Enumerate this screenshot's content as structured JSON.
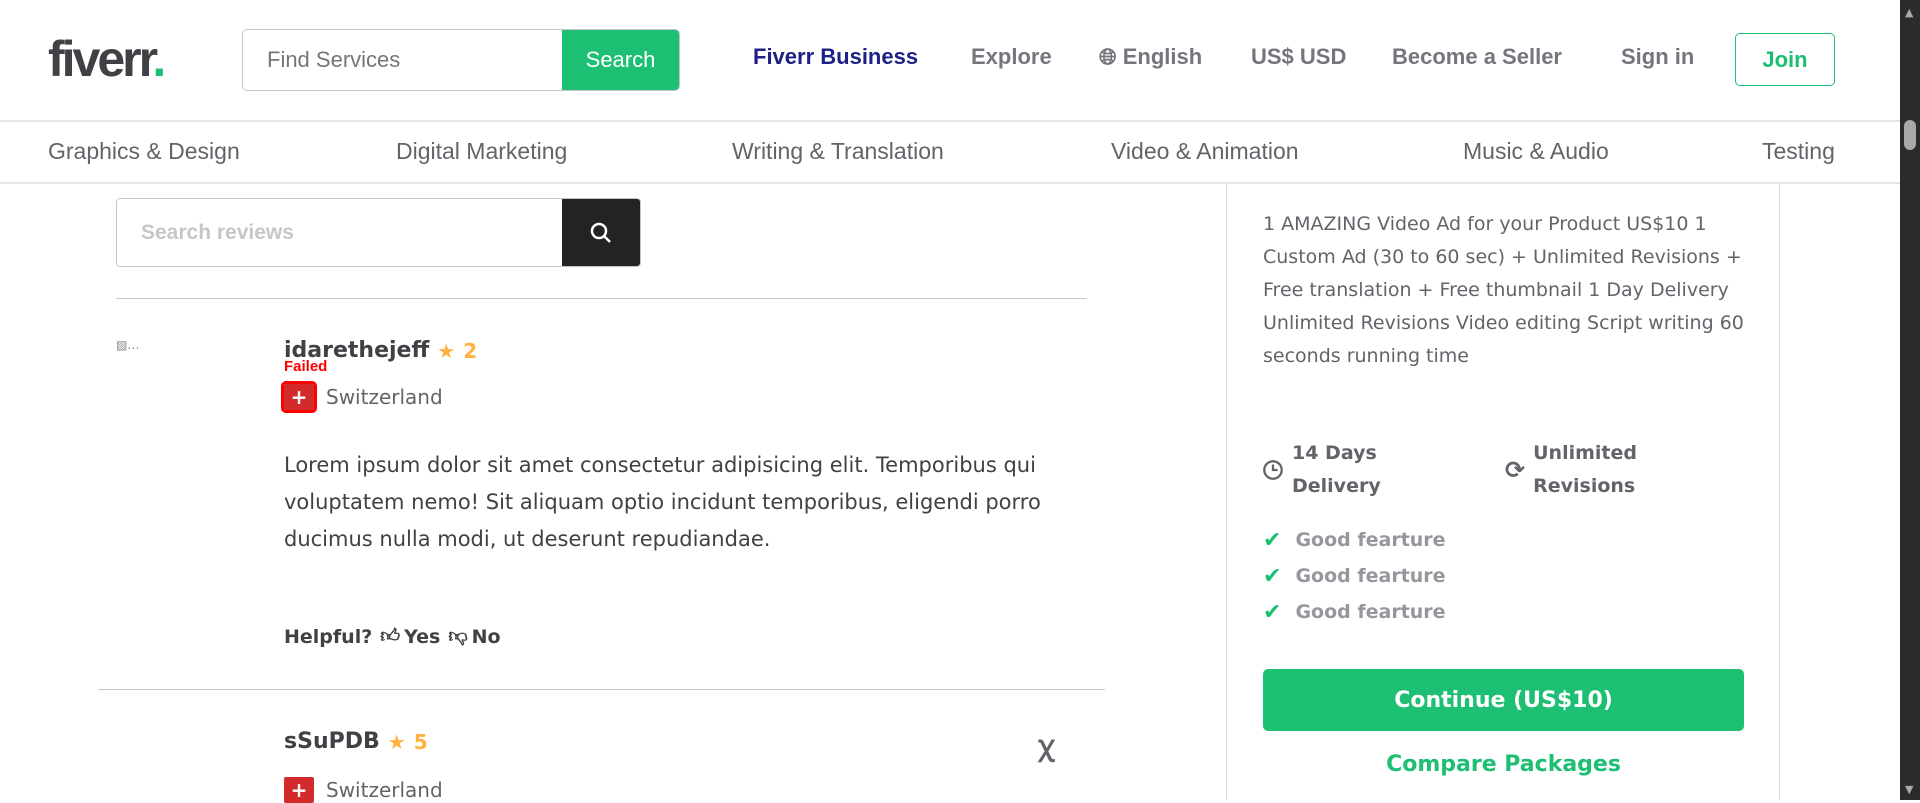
{
  "header": {
    "logo": "fiverr",
    "logo_dot": ".",
    "search_placeholder": "Find Services",
    "search_button": "Search",
    "nav": {
      "business": "Fiverr Business",
      "explore": "Explore",
      "language": "English",
      "currency": "US$ USD",
      "seller": "Become a Seller",
      "signin": "Sign in",
      "join": "Join"
    }
  },
  "categories": [
    "Graphics & Design",
    "Digital Marketing",
    "Writing & Translation",
    "Video & Animation",
    "Music & Audio",
    "Testing"
  ],
  "reviews_search": {
    "placeholder": "Search reviews"
  },
  "reviews": [
    {
      "username": "idarethejeff",
      "rating": "2",
      "flag_status": "Failed",
      "country": "Switzerland",
      "text": "Lorem ipsum dolor sit amet consectetur adipisicing elit. Temporibus qui voluptatem nemo! Sit aliquam optio incidunt temporibus, eligendi porro ducimus nulla modi, ut deserunt repudiandae.",
      "helpful": "Helpful?",
      "yes": "Yes",
      "no": "No"
    },
    {
      "username": "sSuPDB",
      "rating": "5",
      "country": "Switzerland"
    }
  ],
  "package": {
    "description": "1 AMAZING Video Ad for your Product US$10 1 Custom Ad (30 to 60 sec) + Unlimited Revisions + Free translation + Free thumbnail 1 Day Delivery Unlimited Revisions Video editing Script writing 60 seconds running time",
    "delivery": "14 Days Delivery",
    "revisions": "Unlimited Revisions",
    "features": [
      "Good fearture",
      "Good fearture",
      "Good fearture"
    ],
    "continue": "Continue (US$10)",
    "compare": "Compare Packages"
  },
  "colors": {
    "brand": "#1dbf73",
    "business": "#1d2086",
    "star": "#ffb33e"
  }
}
